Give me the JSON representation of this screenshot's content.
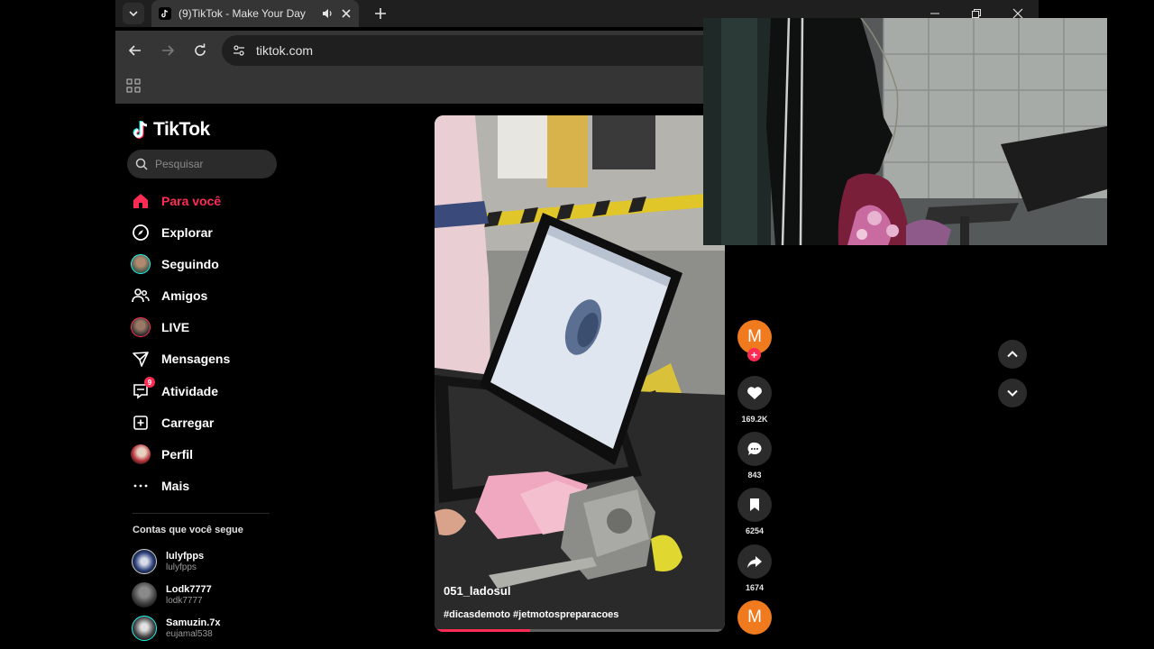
{
  "browser": {
    "tab_title": "(9)TikTok - Make Your Day",
    "url": "tiktok.com"
  },
  "tiktok": {
    "logo_text": "TikTok",
    "search_placeholder": "Pesquisar",
    "nav": [
      {
        "label": "Para você",
        "icon": "home-icon",
        "active": true
      },
      {
        "label": "Explorar",
        "icon": "compass-icon"
      },
      {
        "label": "Seguindo",
        "icon": "following-avatar-icon"
      },
      {
        "label": "Amigos",
        "icon": "friends-icon"
      },
      {
        "label": "LIVE",
        "icon": "live-avatar-icon"
      },
      {
        "label": "Mensagens",
        "icon": "messages-icon"
      },
      {
        "label": "Atividade",
        "icon": "activity-icon",
        "badge": "9"
      },
      {
        "label": "Carregar",
        "icon": "upload-icon"
      },
      {
        "label": "Perfil",
        "icon": "profile-avatar-icon"
      },
      {
        "label": "Mais",
        "icon": "more-icon"
      }
    ],
    "following_title": "Contas que você segue",
    "following": [
      {
        "name": "lulyfpps",
        "handle": "lulyfpps"
      },
      {
        "name": "Lodk7777",
        "handle": "lodk7777"
      },
      {
        "name": "Samuzin.7x",
        "handle": "eujamal538"
      }
    ]
  },
  "video": {
    "author": "051_ladosul",
    "hashtags": "#dicasdemoto #jetmotospreparacoes",
    "progress": 0.33
  },
  "actions": {
    "creator_initial": "M",
    "likes": "169.2K",
    "comments": "843",
    "saves": "6254",
    "shares": "1674"
  },
  "colors": {
    "accent": "#fe2c55",
    "creator_avatar": "#f07a1e"
  }
}
